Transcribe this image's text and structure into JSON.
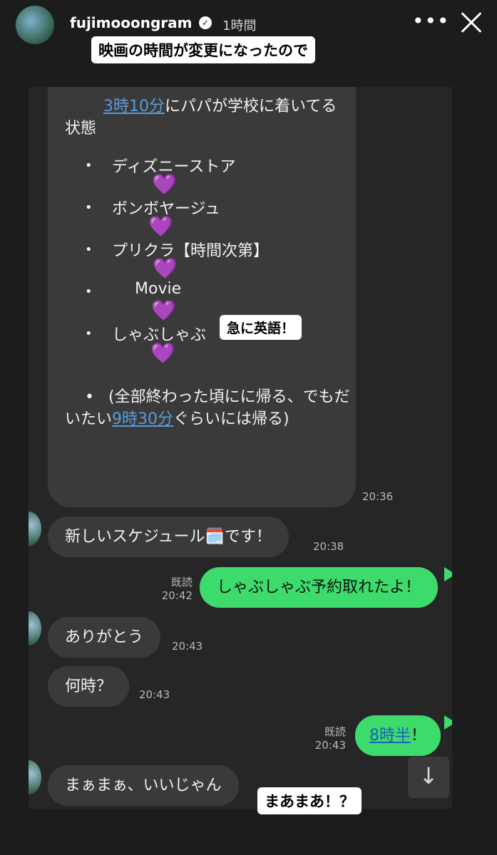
{
  "header": {
    "username": "fujimooongram",
    "verified_icon": "verified-badge-icon",
    "time_ago": "1時間",
    "more_icon": "more-dots-icon",
    "close_icon": "close-icon"
  },
  "captions": {
    "top": "映画の時間が変更になったので",
    "middle": "急に英語！",
    "bottom": "まあまあ！？"
  },
  "colors": {
    "background": "#1c1c1c",
    "chat_bg": "#262626",
    "bubble_gray": "#3a3a3a",
    "bubble_green": "#3ddb6c",
    "link": "#5b9bd8",
    "heart": "#a64ce8"
  },
  "schedule_message": {
    "intro_link": "3時10分",
    "intro_text": "にパパが学校に着いてる状態",
    "items": [
      "ディズニーストア",
      "ボンボヤージュ",
      "プリクラ【時間次第】",
      "Movie",
      "しゃぶしゃぶ"
    ],
    "bullet": "•",
    "heart": "💜",
    "closing_before": "(全部終わった頃にに帰る、でもだいたい",
    "closing_link": "9時30分",
    "closing_after": "ぐらいには帰る)",
    "time": "20:36"
  },
  "messages": [
    {
      "side": "left",
      "text": "新しいスケジュール",
      "emoji": "🗓️",
      "text_after": "です！",
      "time": "20:38"
    },
    {
      "side": "right",
      "read": "既読",
      "text": "しゃぶしゃぶ予約取れたよ！",
      "time": "20:42"
    },
    {
      "side": "left",
      "text": "ありがとう",
      "time": "20:43"
    },
    {
      "side": "left",
      "text": "何時？",
      "time": "20:43"
    },
    {
      "side": "right",
      "read": "既読",
      "link": "8時半",
      "text_after": "！",
      "time": "20:43"
    },
    {
      "side": "left",
      "text": "まぁまぁ、いいじゃん"
    }
  ],
  "scroll_button": {
    "icon": "arrow-down-icon",
    "glyph": "↓"
  }
}
